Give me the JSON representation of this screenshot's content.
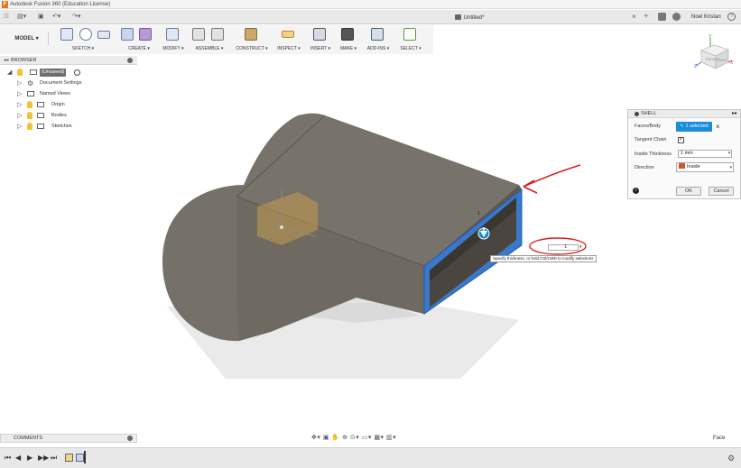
{
  "window": {
    "app_title": "Autodesk Fusion 360 (Education License)"
  },
  "tabbar": {
    "document_title": "Untitled*",
    "user_name": "Noel Kristan"
  },
  "toolbar": {
    "workspace_label": "MODEL",
    "groups": [
      {
        "label": "SKETCH ▾"
      },
      {
        "label": "CREATE ▾"
      },
      {
        "label": "MODIFY ▾"
      },
      {
        "label": "ASSEMBLE ▾"
      },
      {
        "label": "CONSTRUCT ▾"
      },
      {
        "label": "INSPECT ▾"
      },
      {
        "label": "INSERT ▾"
      },
      {
        "label": "MAKE ▾"
      },
      {
        "label": "ADD-INS ▾"
      },
      {
        "label": "SELECT ▾"
      }
    ]
  },
  "viewcube": {
    "top": "TOP",
    "front": "FRONT",
    "right": "RIGHT"
  },
  "browser": {
    "title": "BROWSER",
    "items": [
      {
        "label": "(Unsaved)"
      },
      {
        "label": "Document Settings"
      },
      {
        "label": "Named Views"
      },
      {
        "label": "Origin"
      },
      {
        "label": "Bodies"
      },
      {
        "label": "Sketches"
      }
    ]
  },
  "shell_dialog": {
    "title": "SHELL",
    "faces_label": "Faces/Body",
    "faces_value": "1 selected",
    "tangent_label": "Tangent Chain",
    "tangent_checked": true,
    "thickness_label": "Inside Thickness",
    "thickness_value": "1 mm",
    "direction_label": "Direction",
    "direction_value": "Inside",
    "ok_label": "OK",
    "cancel_label": "Cancel"
  },
  "canvas": {
    "thickness_input": "1",
    "dim_label": "1",
    "tooltip": "Specify thickness, or hold Ctrl/CMD to modify selections"
  },
  "comments": {
    "title": "COMMENTS"
  },
  "status": {
    "selection": "Face"
  },
  "colors": {
    "accent": "#1a8cd8",
    "body": "#6e6a61",
    "annotation": "#d92020"
  }
}
